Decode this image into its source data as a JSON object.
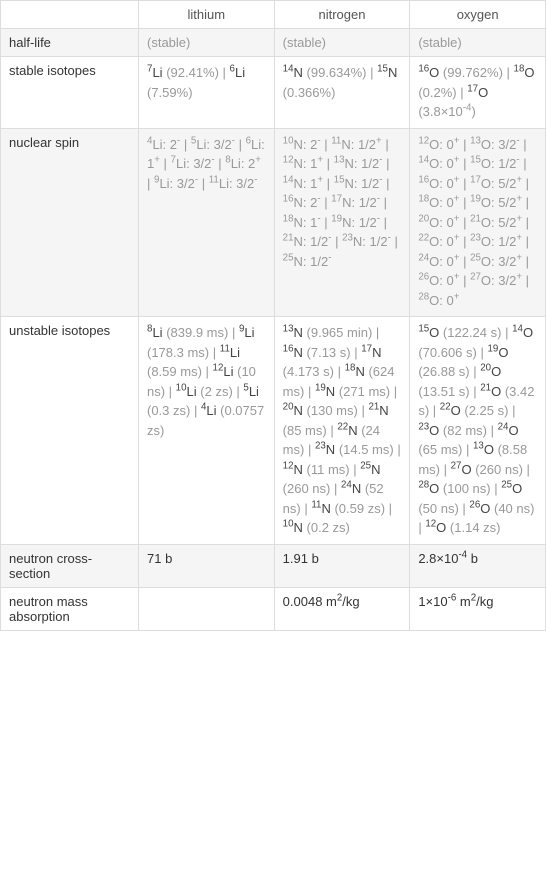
{
  "header": {
    "c1": "lithium",
    "c2": "nitrogen",
    "c3": "oxygen"
  },
  "rows": {
    "half_life": {
      "label": "half-life",
      "li": "(stable)",
      "n": "(stable)",
      "o": "(stable)"
    },
    "stable_isotopes": {
      "label": "stable isotopes",
      "li_html": "<span class='dark'><sup>7</sup>Li</span> <span class='greytext'>(92.41%)</span> | <span class='dark'><sup>6</sup>Li</span> <span class='greytext'>(7.59%)</span>",
      "n_html": "<span class='dark'><sup>14</sup>N</span> <span class='greytext'>(99.634%)</span> | <span class='dark'><sup>15</sup>N</span> <span class='greytext'>(0.366%)</span>",
      "o_html": "<span class='dark'><sup>16</sup>O</span> <span class='greytext'>(99.762%)</span> | <span class='dark'><sup>18</sup>O</span> <span class='greytext'>(0.2%)</span> | <span class='dark'><sup>17</sup>O</span> <span class='greytext'>(3.8×10<sup>-4</sup>)</span>"
    },
    "nuclear_spin": {
      "label": "nuclear spin",
      "li_html": "<sup>4</sup>Li: 2<sup>-</sup> | <sup>5</sup>Li: 3/2<sup>-</sup> | <sup>6</sup>Li: 1<sup>+</sup> | <sup>7</sup>Li: 3/2<sup>-</sup> | <sup>8</sup>Li: 2<sup>+</sup> | <sup>9</sup>Li: 3/2<sup>-</sup> | <sup>11</sup>Li: 3/2<sup>-</sup>",
      "n_html": "<sup>10</sup>N: 2<sup>-</sup> | <sup>11</sup>N: 1/2<sup>+</sup> | <sup>12</sup>N: 1<sup>+</sup> | <sup>13</sup>N: 1/2<sup>-</sup> | <sup>14</sup>N: 1<sup>+</sup> | <sup>15</sup>N: 1/2<sup>-</sup> | <sup>16</sup>N: 2<sup>-</sup> | <sup>17</sup>N: 1/2<sup>-</sup> | <sup>18</sup>N: 1<sup>-</sup> | <sup>19</sup>N: 1/2<sup>-</sup> | <sup>21</sup>N: 1/2<sup>-</sup> | <sup>23</sup>N: 1/2<sup>-</sup> | <sup>25</sup>N: 1/2<sup>-</sup>",
      "o_html": "<sup>12</sup>O: 0<sup>+</sup> | <sup>13</sup>O: 3/2<sup>-</sup> | <sup>14</sup>O: 0<sup>+</sup> | <sup>15</sup>O: 1/2<sup>-</sup> | <sup>16</sup>O: 0<sup>+</sup> | <sup>17</sup>O: 5/2<sup>+</sup> | <sup>18</sup>O: 0<sup>+</sup> | <sup>19</sup>O: 5/2<sup>+</sup> | <sup>20</sup>O: 0<sup>+</sup> | <sup>21</sup>O: 5/2<sup>+</sup> | <sup>22</sup>O: 0<sup>+</sup> | <sup>23</sup>O: 1/2<sup>+</sup> | <sup>24</sup>O: 0<sup>+</sup> | <sup>25</sup>O: 3/2<sup>+</sup> | <sup>26</sup>O: 0<sup>+</sup> | <sup>27</sup>O: 3/2<sup>+</sup> | <sup>28</sup>O: 0<sup>+</sup>"
    },
    "unstable_isotopes": {
      "label": "unstable isotopes",
      "li_html": "<span class='dark'><sup>8</sup>Li</span> <span class='greytext'>(839.9 ms)</span> | <span class='dark'><sup>9</sup>Li</span> <span class='greytext'>(178.3 ms)</span> | <span class='dark'><sup>11</sup>Li</span> <span class='greytext'>(8.59 ms)</span> | <span class='dark'><sup>12</sup>Li</span> <span class='greytext'>(10 ns)</span> | <span class='dark'><sup>10</sup>Li</span> <span class='greytext'>(2 zs)</span> | <span class='dark'><sup>5</sup>Li</span> <span class='greytext'>(0.3 zs)</span> | <span class='dark'><sup>4</sup>Li</span> <span class='greytext'>(0.0757 zs)</span>",
      "n_html": "<span class='dark'><sup>13</sup>N</span> <span class='greytext'>(9.965 min)</span> | <span class='dark'><sup>16</sup>N</span> <span class='greytext'>(7.13 s)</span> | <span class='dark'><sup>17</sup>N</span> <span class='greytext'>(4.173 s)</span> | <span class='dark'><sup>18</sup>N</span> <span class='greytext'>(624 ms)</span> | <span class='dark'><sup>19</sup>N</span> <span class='greytext'>(271 ms)</span> | <span class='dark'><sup>20</sup>N</span> <span class='greytext'>(130 ms)</span> | <span class='dark'><sup>21</sup>N</span> <span class='greytext'>(85 ms)</span> | <span class='dark'><sup>22</sup>N</span> <span class='greytext'>(24 ms)</span> | <span class='dark'><sup>23</sup>N</span> <span class='greytext'>(14.5 ms)</span> | <span class='dark'><sup>12</sup>N</span> <span class='greytext'>(11 ms)</span> | <span class='dark'><sup>25</sup>N</span> <span class='greytext'>(260 ns)</span> | <span class='dark'><sup>24</sup>N</span> <span class='greytext'>(52 ns)</span> | <span class='dark'><sup>11</sup>N</span> <span class='greytext'>(0.59 zs)</span> | <span class='dark'><sup>10</sup>N</span> <span class='greytext'>(0.2 zs)</span>",
      "o_html": "<span class='dark'><sup>15</sup>O</span> <span class='greytext'>(122.24 s)</span> | <span class='dark'><sup>14</sup>O</span> <span class='greytext'>(70.606 s)</span> | <span class='dark'><sup>19</sup>O</span> <span class='greytext'>(26.88 s)</span> | <span class='dark'><sup>20</sup>O</span> <span class='greytext'>(13.51 s)</span> | <span class='dark'><sup>21</sup>O</span> <span class='greytext'>(3.42 s)</span> | <span class='dark'><sup>22</sup>O</span> <span class='greytext'>(2.25 s)</span> | <span class='dark'><sup>23</sup>O</span> <span class='greytext'>(82 ms)</span> | <span class='dark'><sup>24</sup>O</span> <span class='greytext'>(65 ms)</span> | <span class='dark'><sup>13</sup>O</span> <span class='greytext'>(8.58 ms)</span> | <span class='dark'><sup>27</sup>O</span> <span class='greytext'>(260 ns)</span> | <span class='dark'><sup>28</sup>O</span> <span class='greytext'>(100 ns)</span> | <span class='dark'><sup>25</sup>O</span> <span class='greytext'>(50 ns)</span> | <span class='dark'><sup>26</sup>O</span> <span class='greytext'>(40 ns)</span> | <span class='dark'><sup>12</sup>O</span> <span class='greytext'>(1.14 zs)</span>"
    },
    "neutron_cross_section": {
      "label": "neutron cross-section",
      "li": "71 b",
      "n": "1.91 b",
      "o_html": "2.8×10<sup>-4</sup> b"
    },
    "neutron_mass_absorption": {
      "label": "neutron mass absorption",
      "li": "",
      "n_html": "0.0048 m<sup>2</sup>/kg",
      "o_html": "1×10<sup>-6</sup> m<sup>2</sup>/kg"
    }
  }
}
